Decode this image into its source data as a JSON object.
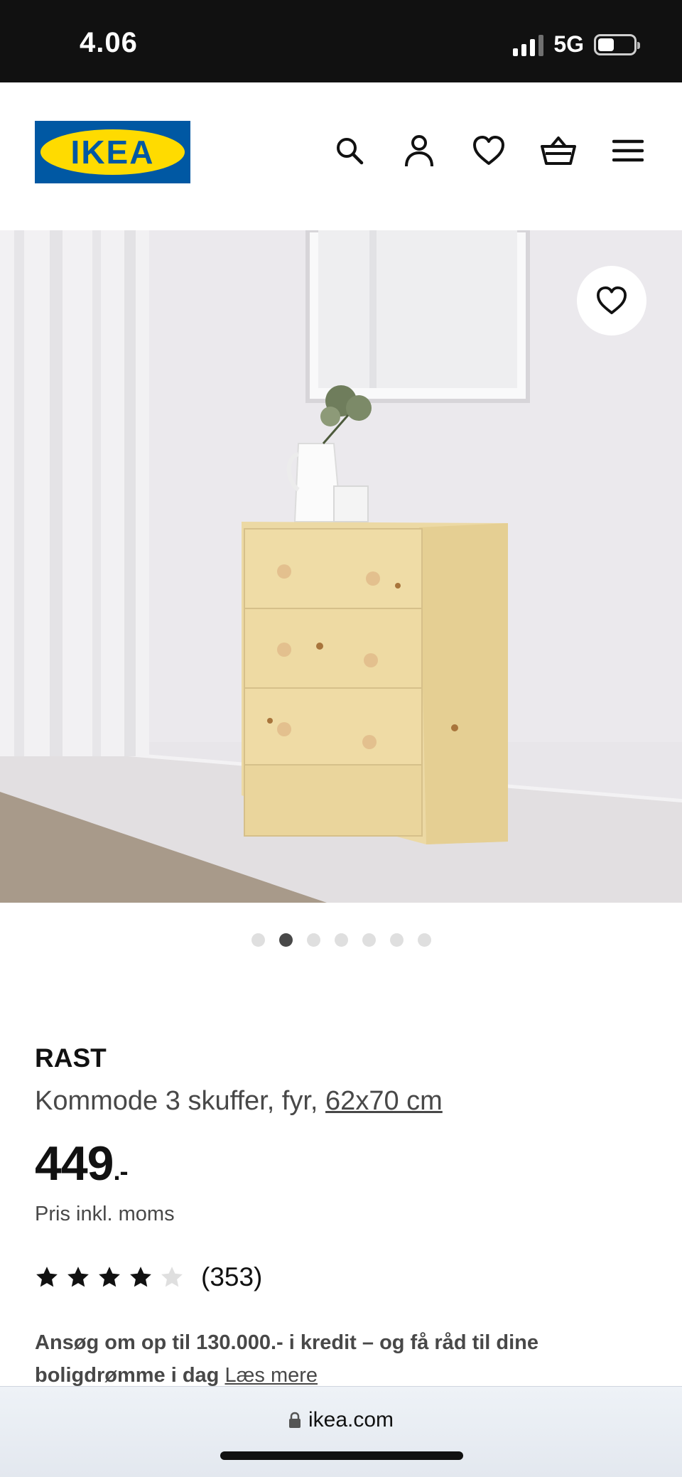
{
  "status_bar": {
    "time": "4.06",
    "network": "5G",
    "battery_level": 0.45
  },
  "header": {
    "logo_text": "IKEA",
    "icons": [
      "search-icon",
      "account-icon",
      "heart-icon",
      "basket-icon",
      "menu-icon"
    ]
  },
  "gallery": {
    "dot_count": 7,
    "active_index": 1
  },
  "product": {
    "brand": "RAST",
    "description": "Kommode 3 skuffer, fyr, ",
    "size": "62x70 cm",
    "price_main": "449",
    "price_suffix": ".-",
    "vat_note": "Pris inkl. moms",
    "rating_value": 4,
    "rating_max": 5,
    "review_count": "(353)"
  },
  "credit": {
    "text": "Ansøg om op til 130.000.- i kredit – og få råd til dine boligdrømme i dag ",
    "link": "Læs mere"
  },
  "browser": {
    "url": "ikea.com"
  },
  "colors": {
    "ikea_blue": "#0058a3",
    "ikea_yellow": "#ffdb00",
    "active_dot": "#484848",
    "inactive_dot": "#dfdfdf"
  }
}
